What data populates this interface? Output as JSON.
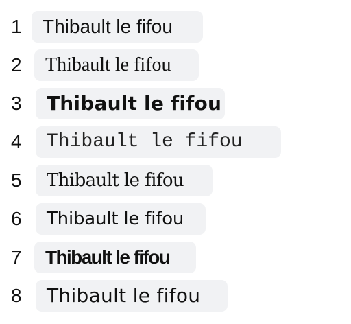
{
  "font_samples": [
    {
      "index": "1",
      "text": "Thibault le fifou"
    },
    {
      "index": "2",
      "text": "Thibault le fifou"
    },
    {
      "index": "3",
      "text": "Thibault le fifou"
    },
    {
      "index": "4",
      "text": "Thibault le fifou"
    },
    {
      "index": "5",
      "text": "Thibault le fifou"
    },
    {
      "index": "6",
      "text": "Thibault le fifou"
    },
    {
      "index": "7",
      "text": "Thibault le fifou"
    },
    {
      "index": "8",
      "text": "Thibault le fifou"
    }
  ],
  "colors": {
    "chip_background": "#f1f2f4",
    "text": "#111111"
  }
}
